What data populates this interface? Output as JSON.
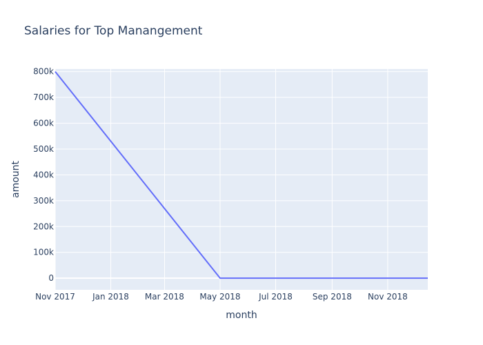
{
  "chart_data": {
    "type": "line",
    "title": "Salaries for Top Manangement",
    "xlabel": "month",
    "ylabel": "amount",
    "x": [
      "2017-11-01",
      "2018-05-01",
      "2018-12-15"
    ],
    "series": [
      {
        "values": [
          800000,
          0,
          0
        ],
        "color": "#636efa"
      }
    ],
    "xlim": [
      "2017-11-01",
      "2018-12-15"
    ],
    "ylim": [
      -45000,
      810000
    ],
    "x_tick_labels": [
      "Nov 2017",
      "Jan 2018",
      "Mar 2018",
      "May 2018",
      "Jul 2018",
      "Sep 2018",
      "Nov 2018"
    ],
    "x_tick_dates": [
      "2017-11-01",
      "2018-01-01",
      "2018-03-01",
      "2018-05-01",
      "2018-07-01",
      "2018-09-01",
      "2018-11-01"
    ],
    "y_tick_labels": [
      "0",
      "100k",
      "200k",
      "300k",
      "400k",
      "500k",
      "600k",
      "700k",
      "800k"
    ],
    "y_tick_values": [
      0,
      100000,
      200000,
      300000,
      400000,
      500000,
      600000,
      700000,
      800000
    ],
    "grid": true,
    "plot_background": "#e5ecf6",
    "grid_color": "#ffffff",
    "text_color": "#2a3f5f"
  }
}
